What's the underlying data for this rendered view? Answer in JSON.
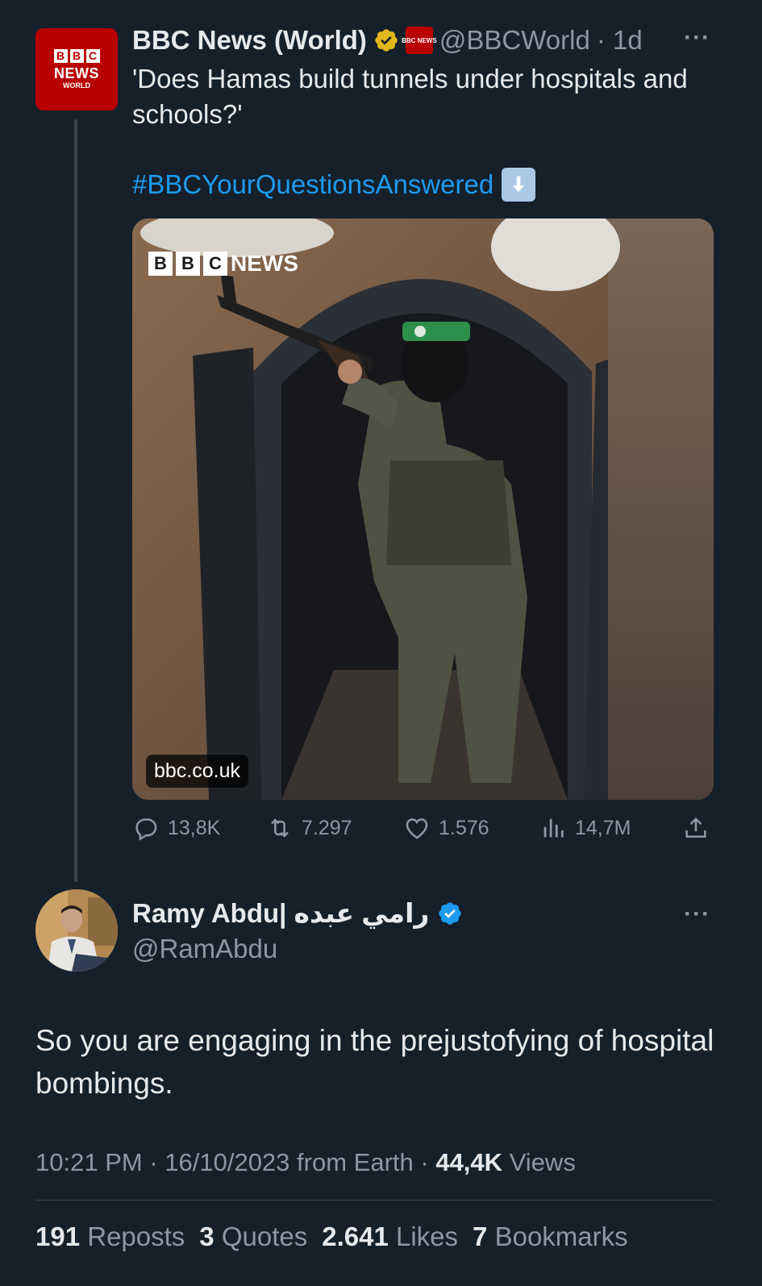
{
  "tweet": {
    "author_name": "BBC News (World)",
    "author_handle": "@BBCWorld",
    "time": "· 1d",
    "avatar_lines": {
      "blocks": [
        "B",
        "B",
        "C"
      ],
      "news": "NEWS",
      "world": "WORLD"
    },
    "affiliation_badge": "BBC NEWS",
    "more_label": "···",
    "text": "'Does Hamas build tunnels under hospitals and schools?'",
    "hashtag": "#BBCYourQuestionsAnswered",
    "hashtag_emoji": "down-arrow-emoji",
    "media": {
      "watermark_blocks": [
        "B",
        "B",
        "C"
      ],
      "watermark_text": "NEWS",
      "link_label": "bbc.co.uk"
    },
    "actions": {
      "replies": "13,8K",
      "reposts": "7.297",
      "likes": "1.576",
      "views": "14,7M"
    },
    "icons": [
      "reply-icon",
      "repost-icon",
      "like-icon",
      "views-icon",
      "share-icon",
      "verified-gold-icon"
    ]
  },
  "reply": {
    "author_name": "Ramy Abdu| رامي عبده",
    "author_handle": "@RamAbdu",
    "more_label": "···",
    "text": "So you are engaging in the prejustofying of hospital bombings.",
    "time": "10:21 PM",
    "date": "16/10/2023",
    "source": "from Earth",
    "views_count": "44,4K",
    "views_label": "Views",
    "stats": {
      "reposts_count": "191",
      "reposts_label": "Reposts",
      "quotes_count": "3",
      "quotes_label": "Quotes",
      "likes_count": "2.641",
      "likes_label": "Likes",
      "bookmarks_count": "7",
      "bookmarks_label": "Bookmarks"
    },
    "icons": [
      "verified-blue-icon"
    ]
  },
  "colors": {
    "background": "#15202b",
    "accent": "#1d9bf0",
    "muted": "#8b98a5",
    "bbc_red": "#b80000"
  }
}
